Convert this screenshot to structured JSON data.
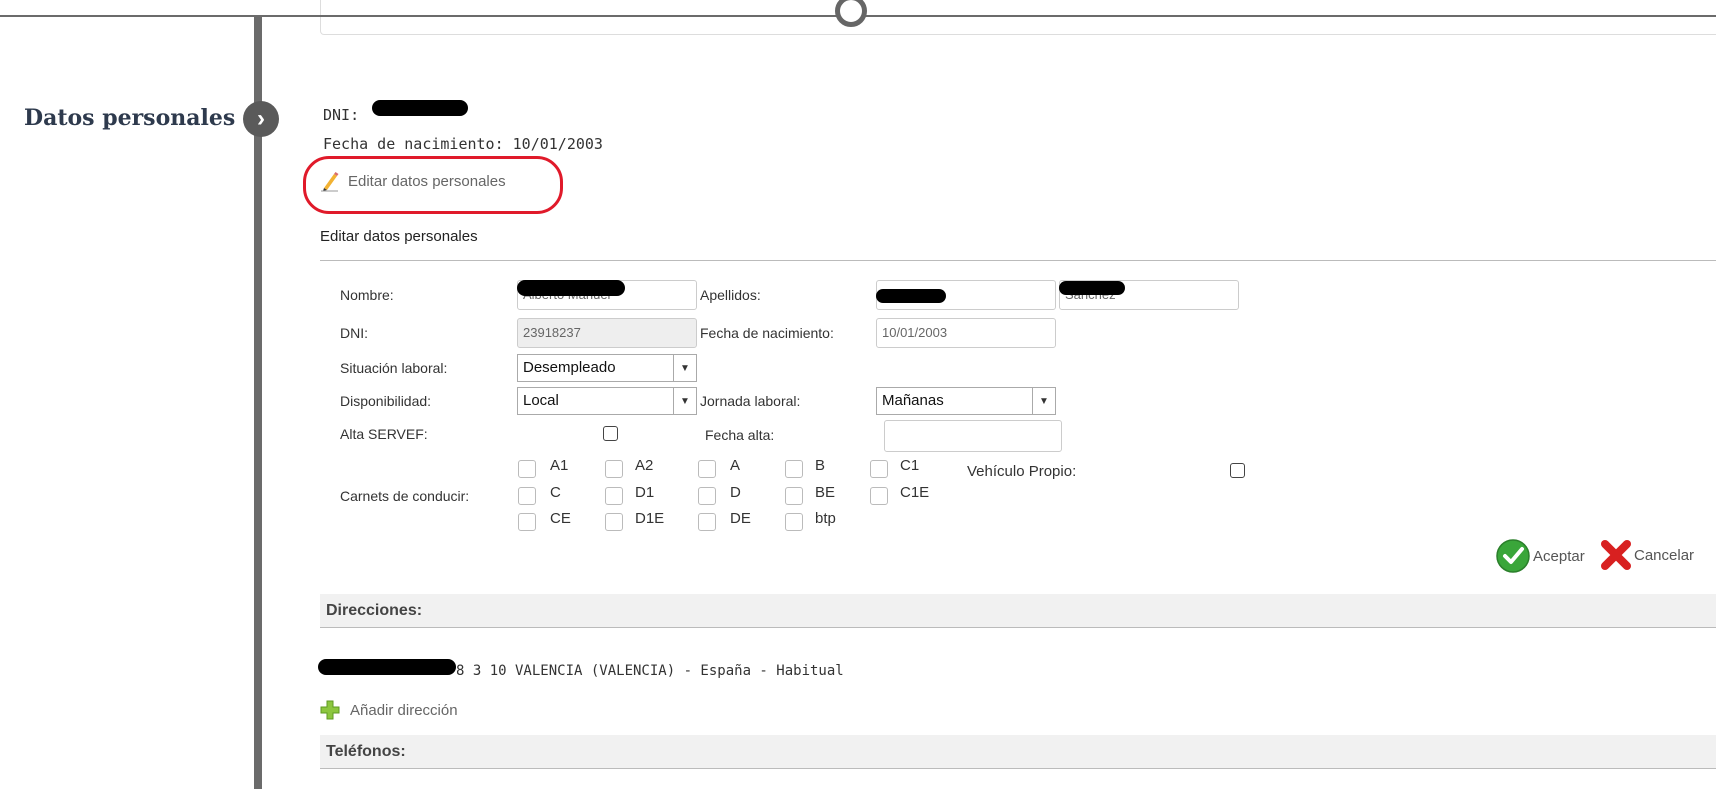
{
  "section": {
    "title": "Datos personales"
  },
  "summary": {
    "dni_label": "DNI:",
    "dob_label": "Fecha de nacimiento:",
    "dob_value": "10/01/2003",
    "edit_link": "Editar datos personales"
  },
  "form": {
    "heading": "Editar datos personales",
    "nombre_label": "Nombre:",
    "nombre_value": "Alberto Manuel",
    "apellidos_label": "Apellidos:",
    "apellido2_value": "Sanchez",
    "dni_label": "DNI:",
    "dni_value": "23918237",
    "fecha_label": "Fecha de nacimiento:",
    "fecha_value": "10/01/2003",
    "situacion_label": "Situación laboral:",
    "situacion_value": "Desempleado",
    "disponibilidad_label": "Disponibilidad:",
    "disponibilidad_value": "Local",
    "jornada_label": "Jornada laboral:",
    "jornada_value": "Mañanas",
    "alta_label": "Alta SERVEF:",
    "fecha_alta_label": "Fecha alta:",
    "carnets_label": "Carnets de conducir:",
    "vehiculo_label": "Vehículo Propio:",
    "carnets": [
      "A1",
      "A2",
      "A",
      "B",
      "C1",
      "C",
      "D1",
      "D",
      "BE",
      "C1E",
      "CE",
      "D1E",
      "DE",
      "btp"
    ],
    "accept": "Aceptar",
    "cancel": "Cancelar"
  },
  "direcciones": {
    "title": "Direcciones:",
    "address": "8 3 10 VALENCIA (VALENCIA) - España - Habitual",
    "add": "Añadir dirección"
  },
  "telefonos": {
    "title": "Teléfonos:"
  },
  "colors": {
    "highlight": "#e01a2a",
    "accept_green": "#3aa63a",
    "cancel_red": "#d82020"
  }
}
